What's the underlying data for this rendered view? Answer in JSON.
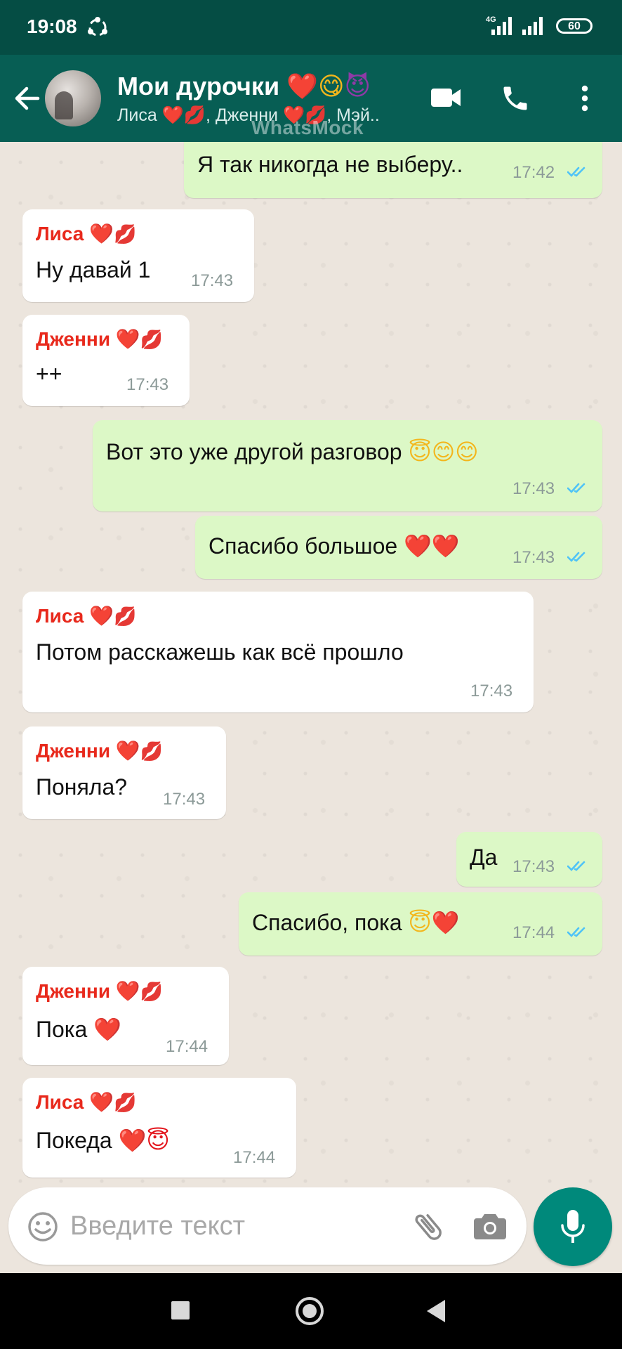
{
  "status_bar": {
    "time": "19:08",
    "network": "4G",
    "battery": "60"
  },
  "header": {
    "title_text": "Мои дурочки",
    "title_emoji": [
      "❤️",
      "😋",
      "😈"
    ],
    "subtitle": "Лиса ❤️💋, Дженни ❤️💋, Мэй..",
    "icons": [
      "back-arrow-icon",
      "video-call-icon",
      "phone-icon",
      "more-vert-icon"
    ]
  },
  "watermark": "WhatsMock",
  "messages": [
    {
      "dir": "out",
      "text": "Я так никогда не выберу..",
      "time": "17:42",
      "read": true
    },
    {
      "dir": "in",
      "sender": "Лиса",
      "text": "Ну давай 1",
      "time": "17:43"
    },
    {
      "dir": "in",
      "sender": "Дженни",
      "text": "++",
      "time": "17:43"
    },
    {
      "dir": "out",
      "text": "Вот это уже другой разговор",
      "emoji": "😇😊😊",
      "time": "17:43",
      "read": true
    },
    {
      "dir": "out",
      "text": "Спасибо большое",
      "emoji": "❤️❤️",
      "time": "17:43",
      "read": true
    },
    {
      "dir": "in",
      "sender": "Лиса",
      "text": "Потом расскажешь как всё прошло",
      "time": "17:43"
    },
    {
      "dir": "in",
      "sender": "Дженни",
      "text": "Поняла?",
      "time": "17:43"
    },
    {
      "dir": "out",
      "text": "Да",
      "time": "17:43",
      "read": true
    },
    {
      "dir": "out",
      "text": "Спасибо, пока",
      "emoji": "😇❤️",
      "time": "17:44",
      "read": true
    },
    {
      "dir": "in",
      "sender": "Дженни",
      "text": "Пока",
      "emoji": "❤️",
      "time": "17:44"
    },
    {
      "dir": "in",
      "sender": "Лиса",
      "text": "Покеда",
      "emoji": "❤️😇",
      "time": "17:44"
    }
  ],
  "sender_emoji": {
    "heart": "❤️",
    "kiss": "💋"
  },
  "input": {
    "placeholder": "Введите текст"
  },
  "colors": {
    "header": "#075e54",
    "status_bar": "#054d44",
    "outgoing": "#dcf8c6",
    "incoming": "#ffffff",
    "sender_name": "#e8291c",
    "mic_button": "#00897b",
    "read_ticks": "#4fc3f7"
  }
}
